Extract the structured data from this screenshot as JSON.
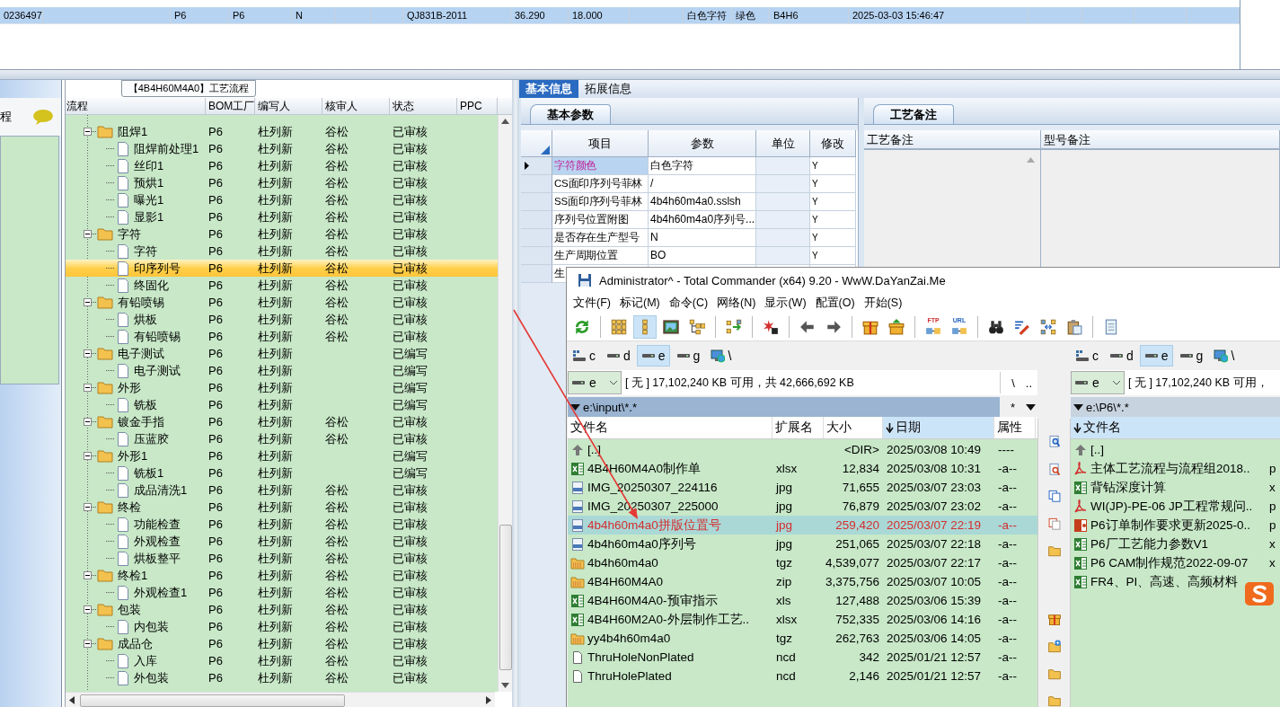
{
  "top_grid": {
    "rows": [
      {
        "selected": true,
        "column_1": "0236497",
        "column_3": "P6",
        "column_4": "P6",
        "column_5": "N",
        "column_8": "QJ831B-2011",
        "column_9": "36.290",
        "column_10": "18.000",
        "column_12": "白色字符",
        "column_13": "绿色",
        "column_14": "B4H6",
        "column_15": "2025-03-03 15:46:47"
      }
    ]
  },
  "side_panel": {
    "title": "程"
  },
  "process_tree": {
    "title": "【4B4H60M4A0】工艺流程",
    "columns": [
      "流程",
      "BOM工厂",
      "编写人",
      "核审人",
      "状态",
      "PPC"
    ],
    "rows": [
      {
        "name": "阻焊1",
        "factory": "P6",
        "writer": "杜列新",
        "reviewer": "谷松",
        "status": "已审核",
        "selected": false,
        "expanded": true,
        "children": [
          {
            "name": "阻焊前处理1",
            "factory": "P6",
            "writer": "杜列新",
            "reviewer": "谷松",
            "status": "已审核",
            "selected": false
          },
          {
            "name": "丝印1",
            "factory": "P6",
            "writer": "杜列新",
            "reviewer": "谷松",
            "status": "已审核",
            "selected": false
          },
          {
            "name": "预烘1",
            "factory": "P6",
            "writer": "杜列新",
            "reviewer": "谷松",
            "status": "已审核",
            "selected": false
          },
          {
            "name": "曝光1",
            "factory": "P6",
            "writer": "杜列新",
            "reviewer": "谷松",
            "status": "已审核",
            "selected": false
          },
          {
            "name": "显影1",
            "factory": "P6",
            "writer": "杜列新",
            "reviewer": "谷松",
            "status": "已审核",
            "selected": false
          }
        ]
      },
      {
        "name": "字符",
        "factory": "P6",
        "writer": "杜列新",
        "reviewer": "谷松",
        "status": "已审核",
        "selected": false,
        "expanded": true,
        "children": [
          {
            "name": "字符",
            "factory": "P6",
            "writer": "杜列新",
            "reviewer": "谷松",
            "status": "已审核",
            "selected": false
          },
          {
            "name": "印序列号",
            "factory": "P6",
            "writer": "杜列新",
            "reviewer": "谷松",
            "status": "已审核",
            "selected": true
          },
          {
            "name": "终固化",
            "factory": "P6",
            "writer": "杜列新",
            "reviewer": "谷松",
            "status": "已审核",
            "selected": false
          }
        ]
      },
      {
        "name": "有铅喷锡",
        "factory": "P6",
        "writer": "杜列新",
        "reviewer": "谷松",
        "status": "已审核",
        "selected": false,
        "expanded": true,
        "children": [
          {
            "name": "烘板",
            "factory": "P6",
            "writer": "杜列新",
            "reviewer": "谷松",
            "status": "已审核",
            "selected": false
          },
          {
            "name": "有铅喷锡",
            "factory": "P6",
            "writer": "杜列新",
            "reviewer": "谷松",
            "status": "已审核",
            "selected": false
          }
        ]
      },
      {
        "name": "电子测试",
        "factory": "P6",
        "writer": "杜列新",
        "status": "已编写",
        "selected": false,
        "expanded": true,
        "children": [
          {
            "name": "电子测试",
            "factory": "P6",
            "writer": "杜列新",
            "status": "已编写",
            "selected": false
          }
        ]
      },
      {
        "name": "外形",
        "factory": "P6",
        "writer": "杜列新",
        "status": "已编写",
        "selected": false,
        "expanded": true,
        "children": [
          {
            "name": "铣板",
            "factory": "P6",
            "writer": "杜列新",
            "status": "已编写",
            "selected": false
          }
        ]
      },
      {
        "name": "镀金手指",
        "factory": "P6",
        "writer": "杜列新",
        "reviewer": "谷松",
        "status": "已审核",
        "selected": false,
        "expanded": true,
        "children": [
          {
            "name": "压蓝胶",
            "factory": "P6",
            "writer": "杜列新",
            "reviewer": "谷松",
            "status": "已审核",
            "selected": false
          }
        ]
      },
      {
        "name": "外形1",
        "factory": "P6",
        "writer": "杜列新",
        "status": "已编写",
        "selected": false,
        "expanded": true,
        "children": [
          {
            "name": "铣板1",
            "factory": "P6",
            "writer": "杜列新",
            "status": "已编写",
            "selected": false
          },
          {
            "name": "成品清洗1",
            "factory": "P6",
            "writer": "杜列新",
            "reviewer": "谷松",
            "status": "已审核",
            "selected": false
          }
        ]
      },
      {
        "name": "终检",
        "factory": "P6",
        "writer": "杜列新",
        "reviewer": "谷松",
        "status": "已审核",
        "selected": false,
        "expanded": true,
        "children": [
          {
            "name": "功能检查",
            "factory": "P6",
            "writer": "杜列新",
            "reviewer": "谷松",
            "status": "已审核",
            "selected": false
          },
          {
            "name": "外观检查",
            "factory": "P6",
            "writer": "杜列新",
            "reviewer": "谷松",
            "status": "已审核",
            "selected": false
          },
          {
            "name": "烘板整平",
            "factory": "P6",
            "writer": "杜列新",
            "reviewer": "谷松",
            "status": "已审核",
            "selected": false
          }
        ]
      },
      {
        "name": "终检1",
        "factory": "P6",
        "writer": "杜列新",
        "reviewer": "谷松",
        "status": "已审核",
        "selected": false,
        "expanded": true,
        "children": [
          {
            "name": "外观检查1",
            "factory": "P6",
            "writer": "杜列新",
            "reviewer": "谷松",
            "status": "已审核",
            "selected": false
          }
        ]
      },
      {
        "name": "包装",
        "factory": "P6",
        "writer": "杜列新",
        "reviewer": "谷松",
        "status": "已审核",
        "selected": false,
        "expanded": true,
        "children": [
          {
            "name": "内包装",
            "factory": "P6",
            "writer": "杜列新",
            "reviewer": "谷松",
            "status": "已审核",
            "selected": false
          }
        ]
      },
      {
        "name": "成品仓",
        "factory": "P6",
        "writer": "杜列新",
        "reviewer": "谷松",
        "status": "已审核",
        "selected": false,
        "expanded": true,
        "children": [
          {
            "name": "入库",
            "factory": "P6",
            "writer": "杜列新",
            "reviewer": "谷松",
            "status": "已审核",
            "selected": false
          },
          {
            "name": "外包装",
            "factory": "P6",
            "writer": "杜列新",
            "reviewer": "谷松",
            "status": "已审核",
            "selected": false
          }
        ]
      }
    ]
  },
  "detail_tabs": [
    {
      "label": "基本信息",
      "selected": true
    },
    {
      "label": "拓展信息",
      "selected": false
    }
  ],
  "basic_params": {
    "tab": "基本参数",
    "columns": [
      "项目",
      "参数",
      "单位",
      "修改"
    ],
    "rows": [
      {
        "item": "字符颜色",
        "value": "白色字符",
        "edit_flag": "Y",
        "selected": true
      },
      {
        "item": "CS面印序列号菲林",
        "value": "/",
        "edit_flag": "Y",
        "selected": false
      },
      {
        "item": "SS面印序列号菲林",
        "value": "4b4h60m4a0.sslsh",
        "edit_flag": "Y",
        "selected": false
      },
      {
        "item": "序列号位置附图",
        "value": "4b4h60m4a0序列号...",
        "edit_flag": "Y",
        "selected": false
      },
      {
        "item": "是否存在生产型号",
        "value": "N",
        "edit_flag": "Y",
        "selected": false
      },
      {
        "item": "生产周期位置",
        "value": "BO",
        "edit_flag": "Y",
        "selected": false
      },
      {
        "item": "生",
        "selected": false
      }
    ]
  },
  "process_notes": {
    "tab": "工艺备注",
    "columns": [
      "工艺备注",
      "型号备注"
    ]
  },
  "commander": {
    "title": "Administrator^ - Total Commander (x64) 9.20 - WwW.DaYanZai.Me",
    "menu": [
      "文件(F)",
      "标记(M)",
      "命令(C)",
      "网络(N)",
      "显示(W)",
      "配置(O)",
      "开始(S)"
    ],
    "toolbar": [
      {
        "kind": "refresh",
        "pressed": false
      },
      {
        "kind": "separator"
      },
      {
        "kind": "brief",
        "pressed": false
      },
      {
        "kind": "detail",
        "pressed": true
      },
      {
        "kind": "thumbs",
        "pressed": false
      },
      {
        "kind": "tree",
        "pressed": false
      },
      {
        "kind": "separator"
      },
      {
        "kind": "compare",
        "pressed": false
      },
      {
        "kind": "separator"
      },
      {
        "kind": "multi",
        "pressed": false
      },
      {
        "kind": "separator"
      },
      {
        "kind": "back",
        "pressed": false
      },
      {
        "kind": "forward",
        "pressed": false
      },
      {
        "kind": "separator"
      },
      {
        "kind": "pack",
        "pressed": false
      },
      {
        "kind": "unpack",
        "pressed": false
      },
      {
        "kind": "separator"
      },
      {
        "kind": "ftp",
        "label": "FTP",
        "pressed": false
      },
      {
        "kind": "url",
        "label": "URL",
        "pressed": false
      },
      {
        "kind": "separator"
      },
      {
        "kind": "search",
        "pressed": false
      },
      {
        "kind": "rename",
        "pressed": false
      },
      {
        "kind": "sync",
        "pressed": false
      },
      {
        "kind": "copynames",
        "pressed": false
      },
      {
        "kind": "separator"
      },
      {
        "kind": "notepad",
        "pressed": false
      }
    ],
    "panels": [
      {
        "active": true,
        "drives": [
          {
            "label": "c",
            "kind": "system",
            "selected": false
          },
          {
            "label": "d",
            "kind": "disk",
            "selected": false
          },
          {
            "label": "e",
            "kind": "disk",
            "selected": true
          },
          {
            "label": "g",
            "kind": "disk",
            "selected": false
          },
          {
            "label": "\\",
            "kind": "network",
            "selected": false
          }
        ],
        "drive_box": "e",
        "free_space": "[ 无 ]  17,102,240 KB 可用，共 42,666,692 KB",
        "nav": [
          "\\",
          ".."
        ],
        "path": "e:\\input\\*.*",
        "filter": "*",
        "columns": [
          {
            "label": "文件名",
            "sorted": false
          },
          {
            "label": "扩展名",
            "sorted": false
          },
          {
            "label": "大小",
            "sorted": false
          },
          {
            "label": "日期",
            "sorted": true
          },
          {
            "label": "属性",
            "sorted": false
          }
        ],
        "files": [
          {
            "name": "[..]",
            "size": "<DIR>",
            "date": "2025/03/08 10:49",
            "attr": "----",
            "kind": "up",
            "selected": false
          },
          {
            "name": "4B4H60M4A0制作单",
            "ext": "xlsx",
            "size": "12,834",
            "date": "2025/03/08 10:31",
            "attr": "-a--",
            "kind": "excel",
            "selected": false
          },
          {
            "name": "IMG_20250307_224116",
            "ext": "jpg",
            "size": "71,655",
            "date": "2025/03/07 23:03",
            "attr": "-a--",
            "kind": "jpg",
            "selected": false
          },
          {
            "name": "IMG_20250307_225000",
            "ext": "jpg",
            "size": "76,879",
            "date": "2025/03/07 23:02",
            "attr": "-a--",
            "kind": "jpg",
            "selected": false
          },
          {
            "name": "4b4h60m4a0拼版位置号",
            "ext": "jpg",
            "size": "259,420",
            "date": "2025/03/07 22:19",
            "attr": "-a--",
            "kind": "jpg",
            "selected": true
          },
          {
            "name": "4b4h60m4a0序列号",
            "ext": "jpg",
            "size": "251,065",
            "date": "2025/03/07 22:18",
            "attr": "-a--",
            "kind": "jpg",
            "selected": false
          },
          {
            "name": "4b4h60m4a0",
            "ext": "tgz",
            "size": "4,539,077",
            "date": "2025/03/07 22:17",
            "attr": "-a--",
            "kind": "archive",
            "selected": false
          },
          {
            "name": "4B4H60M4A0",
            "ext": "zip",
            "size": "3,375,756",
            "date": "2025/03/07 10:05",
            "attr": "-a--",
            "kind": "archive",
            "selected": false
          },
          {
            "name": "4B4H60M4A0-预审指示",
            "ext": "xls",
            "size": "127,488",
            "date": "2025/03/06 15:39",
            "attr": "-a--",
            "kind": "excel",
            "selected": false
          },
          {
            "name": "4B4H60M2A0-外层制作工艺..",
            "ext": "xlsx",
            "size": "752,335",
            "date": "2025/03/06 14:16",
            "attr": "-a--",
            "kind": "excel",
            "selected": false
          },
          {
            "name": "yy4b4h60m4a0",
            "ext": "tgz",
            "size": "262,763",
            "date": "2025/03/06 14:05",
            "attr": "-a--",
            "kind": "archive",
            "selected": false
          },
          {
            "name": "ThruHoleNonPlated",
            "ext": "ncd",
            "size": "342",
            "date": "2025/01/21 12:57",
            "attr": "-a--",
            "kind": "file",
            "selected": false
          },
          {
            "name": "ThruHolePlated",
            "ext": "ncd",
            "size": "2,146",
            "date": "2025/01/21 12:57",
            "attr": "-a--",
            "kind": "file",
            "selected": false
          }
        ]
      },
      {
        "active": false,
        "drives": [
          {
            "label": "c",
            "kind": "system",
            "selected": false
          },
          {
            "label": "d",
            "kind": "disk",
            "selected": false
          },
          {
            "label": "e",
            "kind": "disk",
            "selected": true
          },
          {
            "label": "g",
            "kind": "disk",
            "selected": false
          },
          {
            "label": "\\",
            "kind": "network",
            "selected": false
          }
        ],
        "drive_box": "e",
        "free_space": "[ 无 ]  17,102,240 KB 可用，",
        "path": "e:\\P6\\*.*",
        "columns": [
          {
            "label": "文件名",
            "sorted": true
          }
        ],
        "files": [
          {
            "name": "[..]",
            "kind": "up",
            "selected": false
          },
          {
            "name": "主体工艺流程与流程组2018..",
            "ext": "p",
            "kind": "pdf",
            "selected": false
          },
          {
            "name": "背钻深度计算",
            "ext": "x",
            "kind": "excel",
            "selected": false
          },
          {
            "name": "WI(JP)-PE-06 JP工程常规问..",
            "ext": "p",
            "kind": "pdf",
            "selected": false
          },
          {
            "name": "P6订单制作要求更新2025-0..",
            "ext": "p",
            "kind": "ppt",
            "selected": false
          },
          {
            "name": "P6厂工艺能力参数V1",
            "ext": "x",
            "kind": "excel",
            "selected": false
          },
          {
            "name": "P6 CAM制作规范2022-09-07",
            "ext": "x",
            "kind": "excel",
            "selected": false
          },
          {
            "name": "FR4、PI、高速、高频材料",
            "kind": "excel",
            "selected": false
          }
        ]
      }
    ]
  }
}
